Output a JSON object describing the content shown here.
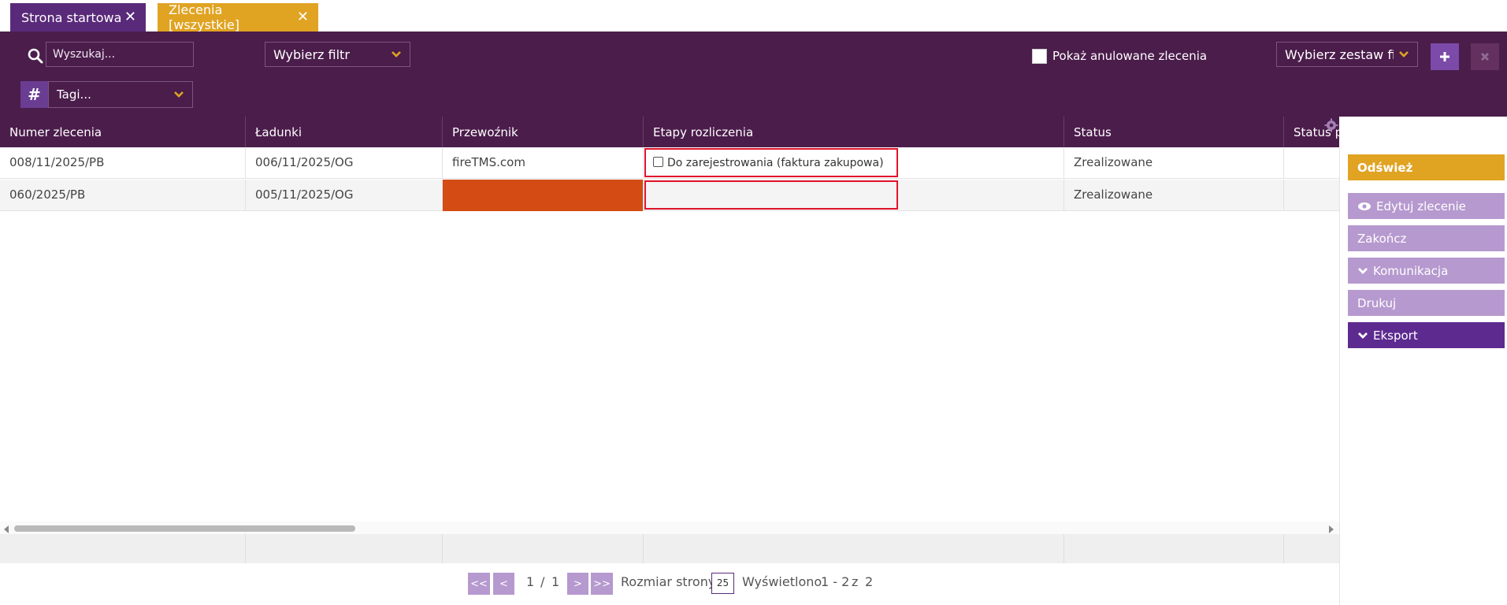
{
  "tabs": [
    {
      "label": "Strona startowa",
      "close": "✕"
    },
    {
      "label": "Zlecenia [wszystkie]",
      "close": "✕"
    }
  ],
  "toolbar": {
    "search_placeholder": "Wyszukaj...",
    "filter_label": "Wybierz filtr",
    "tags_label": "Tagi...",
    "show_cancelled_label": "Pokaż anulowane zlecenia",
    "filterset_label": "Wybierz zestaw filtrów"
  },
  "table": {
    "columns": [
      "Numer zlecenia",
      "Ładunki",
      "Przewoźnik",
      "Etapy rozliczenia",
      "Status",
      "Status p..."
    ],
    "rows": [
      {
        "order": "008/11/2025/PB",
        "loads": "006/11/2025/OG",
        "carrier": "fireTMS.com",
        "stage": "Do zarejestrowania (faktura zakupowa)",
        "status": "Zrealizowane"
      },
      {
        "order": "060/2025/PB",
        "loads": "005/11/2025/OG",
        "carrier": "",
        "stage": "",
        "status": "Zrealizowane"
      }
    ]
  },
  "pagination": {
    "first": "<<",
    "prev": "<",
    "current": "1",
    "sep": "/",
    "total": "1",
    "next": ">",
    "last": ">>",
    "size_label": "Rozmiar strony:",
    "size": "25",
    "shown_label": "Wyświetlono",
    "shown_range": "1 - 2",
    "of": "z",
    "count": "2"
  },
  "actions": {
    "refresh": "Odśwież",
    "edit": "Edytuj zlecenie",
    "finish": "Zakończ",
    "communication": "Komunikacja",
    "print": "Drukuj",
    "export": "Eksport"
  },
  "colors": {
    "toolbar_bg": "#4b1d4b",
    "tab_home": "#5a2a7a",
    "tab_active": "#e0a322",
    "carrier_highlight": "#d44b14",
    "highlight_border": "#e0142a",
    "accent_yellow": "#e0a322"
  }
}
